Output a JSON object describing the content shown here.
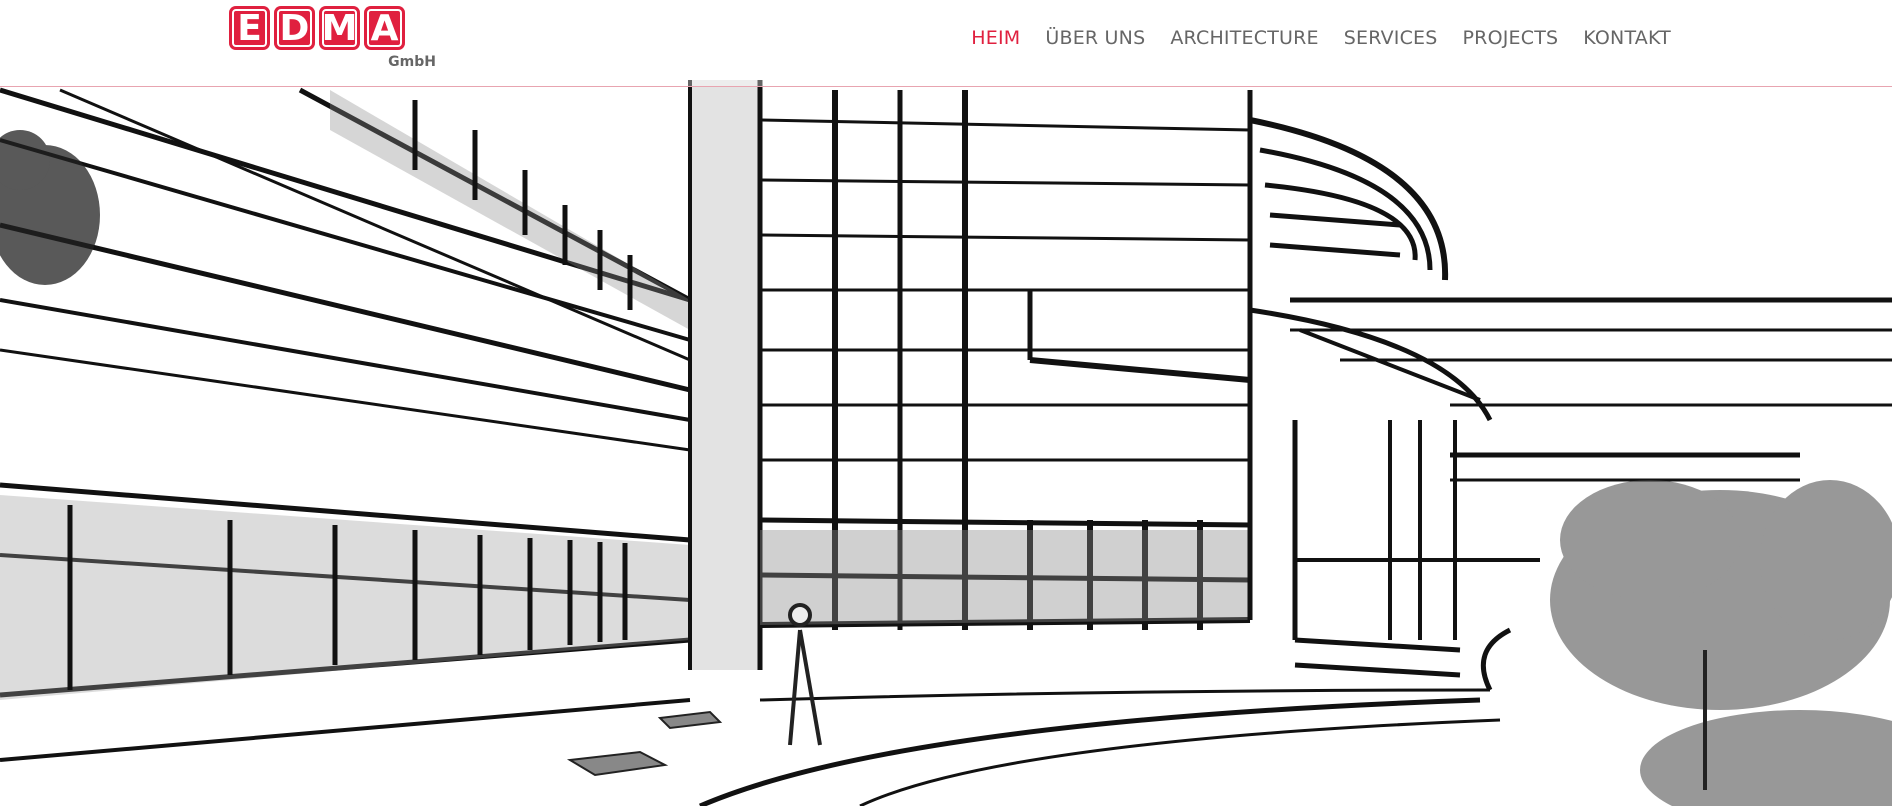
{
  "brand": {
    "letters": [
      "E",
      "D",
      "M",
      "A"
    ],
    "subtitle": "GmbH",
    "color": "#e0203f"
  },
  "nav": {
    "items": [
      {
        "label": "HEIM",
        "active": true
      },
      {
        "label": "ÜBER UNS",
        "active": false
      },
      {
        "label": "ARCHITECTURE",
        "active": false
      },
      {
        "label": "SERVICES",
        "active": false
      },
      {
        "label": "PROJECTS",
        "active": false
      },
      {
        "label": "KONTAKT",
        "active": false
      }
    ],
    "active_color": "#e0203f",
    "text_color": "#666666"
  },
  "hero": {
    "style": "pencil-sketch",
    "subject": "modern-building-courtyard"
  }
}
